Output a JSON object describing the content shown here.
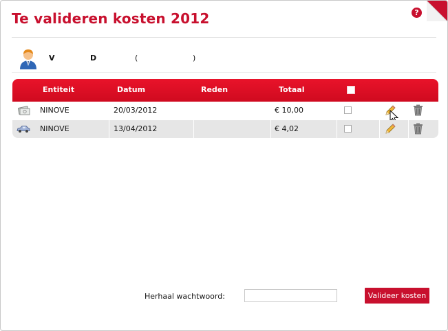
{
  "page": {
    "title": "Te valideren kosten 2012",
    "help_label": "?"
  },
  "user": {
    "field_v": "V",
    "field_d": "D",
    "paren_open": "(",
    "paren_close": ")"
  },
  "table": {
    "columns": [
      "Entiteit",
      "Datum",
      "Reden",
      "Totaal"
    ],
    "rows": [
      {
        "type_icon": "money-icon",
        "entiteit": "NINOVE",
        "datum": "20/03/2012",
        "reden": "",
        "totaal": "€ 10,00"
      },
      {
        "type_icon": "car-icon",
        "entiteit": "NINOVE",
        "datum": "13/04/2012",
        "reden": "",
        "totaal": "€ 4,02"
      }
    ]
  },
  "form": {
    "password_label": "Herhaal wachtwoord:",
    "password_value": "",
    "submit_label": "Valideer kosten"
  },
  "colors": {
    "accent": "#c8102e",
    "row_bg": "#e6e6e6"
  }
}
